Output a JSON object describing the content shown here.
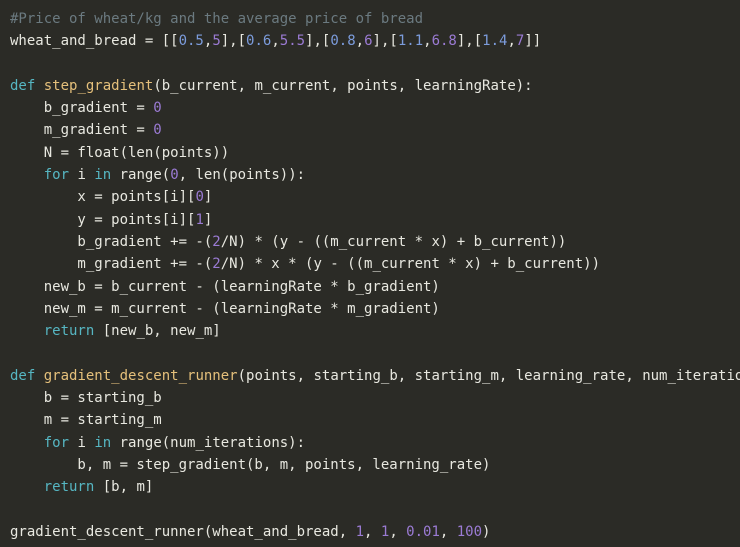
{
  "editor": {
    "background_color": "#2b2b26",
    "default_text_color": "#e8e8e0",
    "font_size_px": 14,
    "line_height_px": 22.3,
    "language": "python"
  },
  "palette": {
    "comment": "#6b7a80",
    "keyword": "#56b6c2",
    "function_name": "#e5c07b",
    "number": "#9b7bd4",
    "number_alt": "#7c9cdc",
    "text": "#e8e8e0"
  },
  "code": {
    "lines": [
      {
        "id": "line-1",
        "tokens": [
          {
            "t": "#Price of wheat/kg and the average price of bread",
            "c": "com"
          }
        ]
      },
      {
        "id": "line-2",
        "tokens": [
          {
            "t": "wheat_and_bread = [[",
            "c": "txt"
          },
          {
            "t": "0.5",
            "c": "num2"
          },
          {
            "t": ",",
            "c": "txt"
          },
          {
            "t": "5",
            "c": "num"
          },
          {
            "t": "],[",
            "c": "txt"
          },
          {
            "t": "0.6",
            "c": "num2"
          },
          {
            "t": ",",
            "c": "txt"
          },
          {
            "t": "5.5",
            "c": "num"
          },
          {
            "t": "],[",
            "c": "txt"
          },
          {
            "t": "0.8",
            "c": "num2"
          },
          {
            "t": ",",
            "c": "txt"
          },
          {
            "t": "6",
            "c": "num"
          },
          {
            "t": "],[",
            "c": "txt"
          },
          {
            "t": "1.1",
            "c": "num2"
          },
          {
            "t": ",",
            "c": "txt"
          },
          {
            "t": "6.8",
            "c": "num"
          },
          {
            "t": "],[",
            "c": "txt"
          },
          {
            "t": "1.4",
            "c": "num2"
          },
          {
            "t": ",",
            "c": "txt"
          },
          {
            "t": "7",
            "c": "num"
          },
          {
            "t": "]]",
            "c": "txt"
          }
        ]
      },
      {
        "id": "line-3",
        "tokens": []
      },
      {
        "id": "line-4",
        "tokens": [
          {
            "t": "def",
            "c": "kw"
          },
          {
            "t": " ",
            "c": "txt"
          },
          {
            "t": "step_gradient",
            "c": "fn"
          },
          {
            "t": "(b_current, m_current, points, learningRate):",
            "c": "txt"
          }
        ]
      },
      {
        "id": "line-5",
        "tokens": [
          {
            "t": "    b_gradient = ",
            "c": "txt"
          },
          {
            "t": "0",
            "c": "num"
          }
        ]
      },
      {
        "id": "line-6",
        "tokens": [
          {
            "t": "    m_gradient = ",
            "c": "txt"
          },
          {
            "t": "0",
            "c": "num"
          }
        ]
      },
      {
        "id": "line-7",
        "tokens": [
          {
            "t": "    N = float(len(points))",
            "c": "txt"
          }
        ]
      },
      {
        "id": "line-8",
        "tokens": [
          {
            "t": "    ",
            "c": "txt"
          },
          {
            "t": "for",
            "c": "kw"
          },
          {
            "t": " i ",
            "c": "txt"
          },
          {
            "t": "in",
            "c": "kw"
          },
          {
            "t": " range(",
            "c": "txt"
          },
          {
            "t": "0",
            "c": "num"
          },
          {
            "t": ", len(points)):",
            "c": "txt"
          }
        ]
      },
      {
        "id": "line-9",
        "tokens": [
          {
            "t": "        x = points[i][",
            "c": "txt"
          },
          {
            "t": "0",
            "c": "num"
          },
          {
            "t": "]",
            "c": "txt"
          }
        ]
      },
      {
        "id": "line-10",
        "tokens": [
          {
            "t": "        y = points[i][",
            "c": "txt"
          },
          {
            "t": "1",
            "c": "num"
          },
          {
            "t": "]",
            "c": "txt"
          }
        ]
      },
      {
        "id": "line-11",
        "tokens": [
          {
            "t": "        b_gradient += -(",
            "c": "txt"
          },
          {
            "t": "2",
            "c": "num"
          },
          {
            "t": "/N) * (y - ((m_current * x) + b_current))",
            "c": "txt"
          }
        ]
      },
      {
        "id": "line-12",
        "tokens": [
          {
            "t": "        m_gradient += -(",
            "c": "txt"
          },
          {
            "t": "2",
            "c": "num"
          },
          {
            "t": "/N) * x * (y - ((m_current * x) + b_current))",
            "c": "txt"
          }
        ]
      },
      {
        "id": "line-13",
        "tokens": [
          {
            "t": "    new_b = b_current - (learningRate * b_gradient)",
            "c": "txt"
          }
        ]
      },
      {
        "id": "line-14",
        "tokens": [
          {
            "t": "    new_m = m_current - (learningRate * m_gradient)",
            "c": "txt"
          }
        ]
      },
      {
        "id": "line-15",
        "tokens": [
          {
            "t": "    ",
            "c": "txt"
          },
          {
            "t": "return",
            "c": "kw"
          },
          {
            "t": " [new_b, new_m]",
            "c": "txt"
          }
        ]
      },
      {
        "id": "line-16",
        "tokens": []
      },
      {
        "id": "line-17",
        "tokens": [
          {
            "t": "def",
            "c": "kw"
          },
          {
            "t": " ",
            "c": "txt"
          },
          {
            "t": "gradient_descent_runner",
            "c": "fn"
          },
          {
            "t": "(points, starting_b, starting_m, learning_rate, num_iterations):",
            "c": "txt"
          }
        ]
      },
      {
        "id": "line-18",
        "tokens": [
          {
            "t": "    b = starting_b",
            "c": "txt"
          }
        ]
      },
      {
        "id": "line-19",
        "tokens": [
          {
            "t": "    m = starting_m",
            "c": "txt"
          }
        ]
      },
      {
        "id": "line-20",
        "tokens": [
          {
            "t": "    ",
            "c": "txt"
          },
          {
            "t": "for",
            "c": "kw"
          },
          {
            "t": " i ",
            "c": "txt"
          },
          {
            "t": "in",
            "c": "kw"
          },
          {
            "t": " range(num_iterations):",
            "c": "txt"
          }
        ]
      },
      {
        "id": "line-21",
        "tokens": [
          {
            "t": "        b, m = step_gradient(b, m, points, learning_rate)",
            "c": "txt"
          }
        ]
      },
      {
        "id": "line-22",
        "tokens": [
          {
            "t": "    ",
            "c": "txt"
          },
          {
            "t": "return",
            "c": "kw"
          },
          {
            "t": " [b, m]",
            "c": "txt"
          }
        ]
      },
      {
        "id": "line-23",
        "tokens": []
      },
      {
        "id": "line-24",
        "tokens": [
          {
            "t": "gradient_descent_runner(wheat_and_bread, ",
            "c": "txt"
          },
          {
            "t": "1",
            "c": "num"
          },
          {
            "t": ", ",
            "c": "txt"
          },
          {
            "t": "1",
            "c": "num"
          },
          {
            "t": ", ",
            "c": "txt"
          },
          {
            "t": "0.01",
            "c": "num"
          },
          {
            "t": ", ",
            "c": "txt"
          },
          {
            "t": "100",
            "c": "num"
          },
          {
            "t": ")",
            "c": "txt"
          }
        ]
      }
    ]
  }
}
